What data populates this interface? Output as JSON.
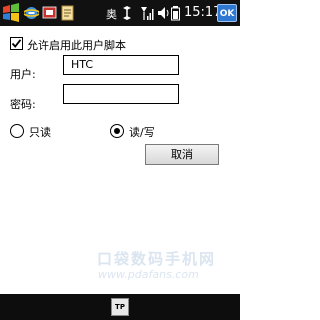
{
  "statusbar": {
    "title": "奥",
    "clock": "15:17",
    "ok_label": "OK",
    "icons": [
      "start-icon",
      "internet-explorer-icon",
      "messaging-icon",
      "notes-icon",
      "connectivity-icon",
      "signal-icon",
      "volume-icon",
      "battery-icon"
    ]
  },
  "form": {
    "checkbox_label": "允许启用此用户脚本",
    "checkbox_checked": true,
    "username_label": "用户:",
    "username_value": "HTC",
    "password_label": "密码:",
    "password_value": "",
    "radio_readonly_label": "只读",
    "radio_readwrite_label": "读/写",
    "selected_mode": "读/写",
    "cancel_label": "取消"
  },
  "watermark": {
    "site_name": "口袋数码手机网",
    "url": "www.pdafans.com"
  },
  "softkeys": {
    "sip_label": "TP"
  },
  "colors": {
    "statusbar_bg": "#111111",
    "ok_button": "#2f78d2",
    "watermark": "#dbe5f0"
  }
}
